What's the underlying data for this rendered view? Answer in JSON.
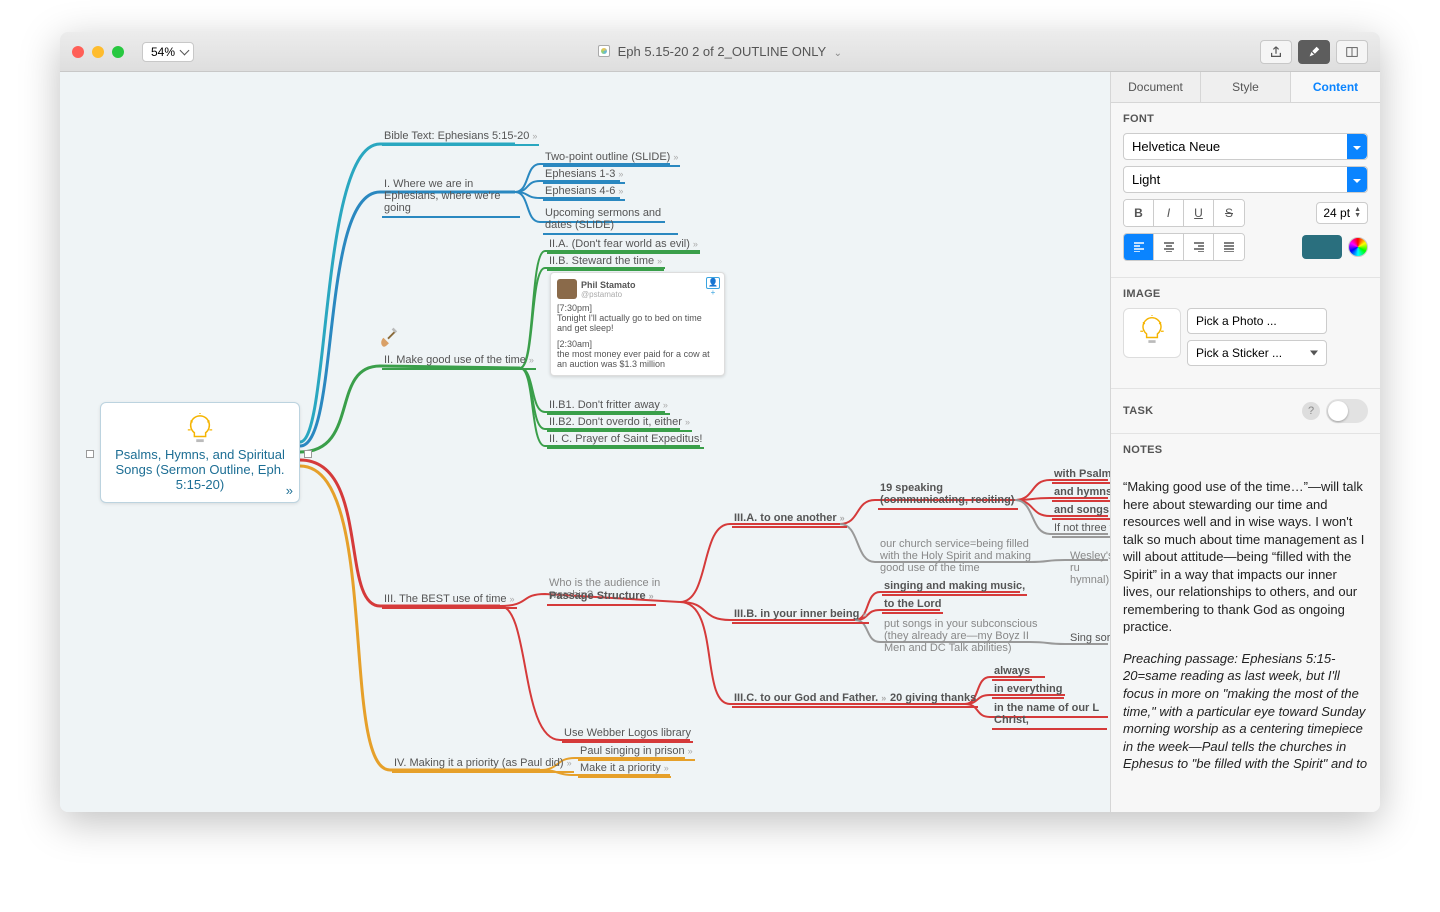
{
  "zoom": "54%",
  "title": "Eph 5.15-20 2 of 2_OUTLINE ONLY",
  "sidebar": {
    "tabs": {
      "document": "Document",
      "style": "Style",
      "content": "Content"
    },
    "font": {
      "label": "FONT",
      "family": "Helvetica Neue",
      "weight": "Light",
      "size": "24 pt"
    },
    "format": {
      "bold": "B",
      "italic": "I",
      "underline": "U",
      "strike": "S"
    },
    "image": {
      "label": "IMAGE",
      "pick_photo": "Pick a Photo ...",
      "pick_sticker": "Pick a Sticker ..."
    },
    "task": {
      "label": "TASK"
    },
    "notes": {
      "label": "NOTES",
      "p1": "“Making good use of the time…”—will talk here about stewarding our time and resources well and in wise ways. I won't talk so much about time management as I will about attitude—being “filled with the Spirit” in a way that impacts our inner lives, our relationships to others, and our remembering to thank God as ongoing practice.",
      "p2": "Preaching passage: Ephesians 5:15-20=same reading as last week, but I'll focus in more on \"making the most of the time,\" with a particular eye toward Sunday morning worship as a centering timepiece in the week—Paul tells the churches in Ephesus to \"be filled with the Spirit\" and to"
    }
  },
  "root": {
    "title": "Psalms, Hymns, and Spiritual Songs (Sermon Outline, Eph. 5:15-20)"
  },
  "nodes": {
    "bible": "Bible Text: Ephesians 5:15-20",
    "where": "I. Where we are in Ephesians, where we're going",
    "twopoint": "Two-point outline (SLIDE)",
    "eph13": "Ephesians 1-3",
    "eph46": "Ephesians 4-6",
    "upcoming": "Upcoming sermons and dates (SLIDE)",
    "ii": "II. Make good use of the time",
    "iia": "II.A. (Don't fear world as evil)",
    "iib": "II.B. Steward the time",
    "iib1": "II.B1. Don't fritter away",
    "iib2": "II.B2. Don't overdo it, either",
    "iic": "II. C. Prayer of Saint Expeditus!",
    "iii": "III. The BEST use of time",
    "whois": "Who is the audience in worship?",
    "passage": "Passage Structure",
    "webber": "Use Webber Logos library",
    "iiia": "III.A. to one another",
    "iiib": "III.B. in your inner being",
    "iiic": "III.C. to our God and Father.",
    "speaking": "19 speaking (communicating, reciting)",
    "church": "our church service=being filled with the Holy Spirit and making good use of the time",
    "singing": "singing and making music,",
    "tolord": "to the Lord",
    "putsongs": "put songs in your subconscious (they already are—my Boyz II Men and DC Talk abilities)",
    "thanks": "20 giving thanks",
    "psalms": "with Psalms",
    "hymns": "and hymns",
    "songsin": "and songs in",
    "ifnot": "If not three ty",
    "wesley": "Wesley's ru hymnal)",
    "singsor": "Sing sor",
    "always": "always",
    "inevery": "in everything",
    "inname": "in the name of our L Christ,",
    "iv": "IV. Making it a priority (as Paul did)",
    "paul": "Paul singing in prison",
    "makepri": "Make it a priority"
  },
  "tweet": {
    "name": "Phil Stamato",
    "handle": "@pstamato",
    "t1": "[7:30pm]",
    "b1": "Tonight I'll actually go to bed on time and get sleep!",
    "t2": "[2:30am]",
    "b2": "the most money ever paid for a cow at an auction was $1.3 million"
  }
}
